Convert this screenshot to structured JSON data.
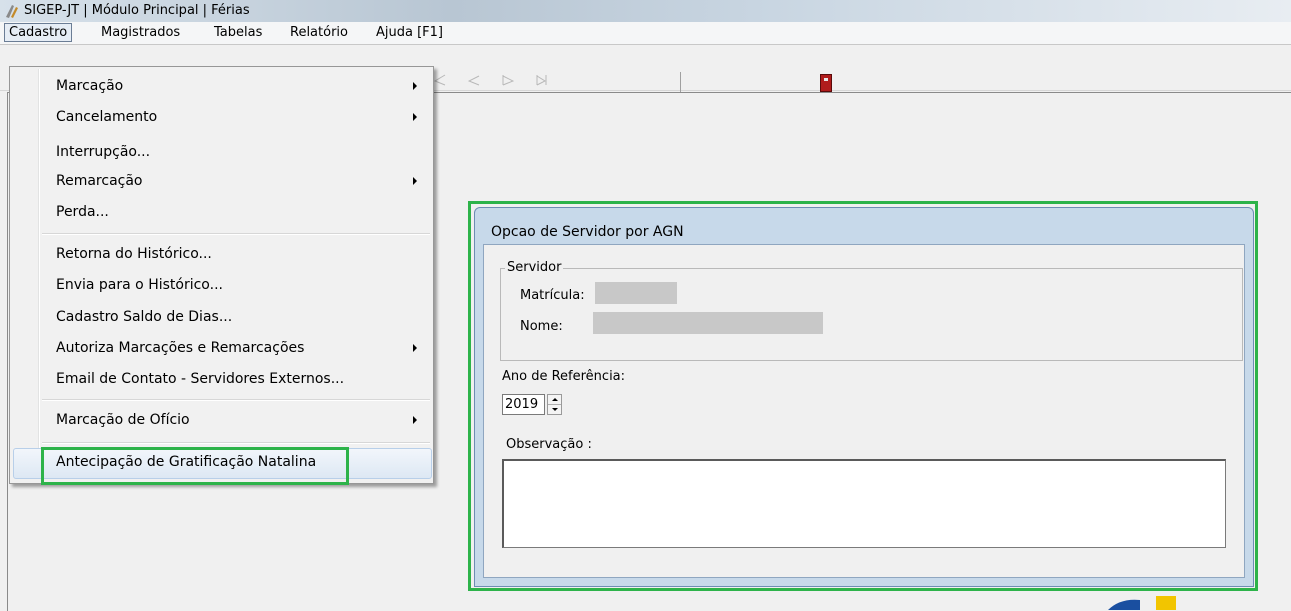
{
  "window": {
    "title": "SIGEP-JT | Módulo Principal | Férias"
  },
  "menubar": {
    "items": [
      "Cadastro",
      "Magistrados",
      "Tabelas",
      "Relatório",
      "Ajuda [F1]"
    ],
    "open_item": "Cadastro"
  },
  "toolbar": {
    "nav_icons": [
      "first-record-icon",
      "previous-record-icon",
      "next-record-icon",
      "last-record-icon"
    ],
    "exit_icon": "exit-door-icon"
  },
  "cadastro_menu": {
    "items": [
      {
        "label": "Marcação",
        "submenu": true
      },
      {
        "label": "Cancelamento",
        "submenu": true
      },
      {
        "label": "Interrupção...",
        "submenu": false
      },
      {
        "label": "Remarcação",
        "submenu": true
      },
      {
        "label": "Perda...",
        "submenu": false
      },
      {
        "label": "Retorna do Histórico...",
        "submenu": false
      },
      {
        "label": "Envia para o Histórico...",
        "submenu": false
      },
      {
        "label": "Cadastro Saldo de Dias...",
        "submenu": false
      },
      {
        "label": "Autoriza Marcações e Remarcações",
        "submenu": true
      },
      {
        "label": "Email de Contato - Servidores Externos...",
        "submenu": false
      },
      {
        "label": "Marcação de Ofício",
        "submenu": true
      },
      {
        "label": "Antecipação de Gratificação Natalina",
        "submenu": false,
        "highlighted": true
      }
    ]
  },
  "dialog": {
    "title": "Opcao de Servidor por AGN",
    "servidor_group": {
      "legend": "Servidor",
      "matricula_label": "Matrícula:",
      "nome_label": "Nome:"
    },
    "ano_referencia": {
      "label": "Ano de Referência:",
      "value": "2019"
    },
    "observacao": {
      "label": "Observação :",
      "value": ""
    }
  },
  "colors": {
    "highlight_green": "#2db34a",
    "dialog_frame": "#c7d9ea",
    "exit_icon": "#b01c1c"
  }
}
